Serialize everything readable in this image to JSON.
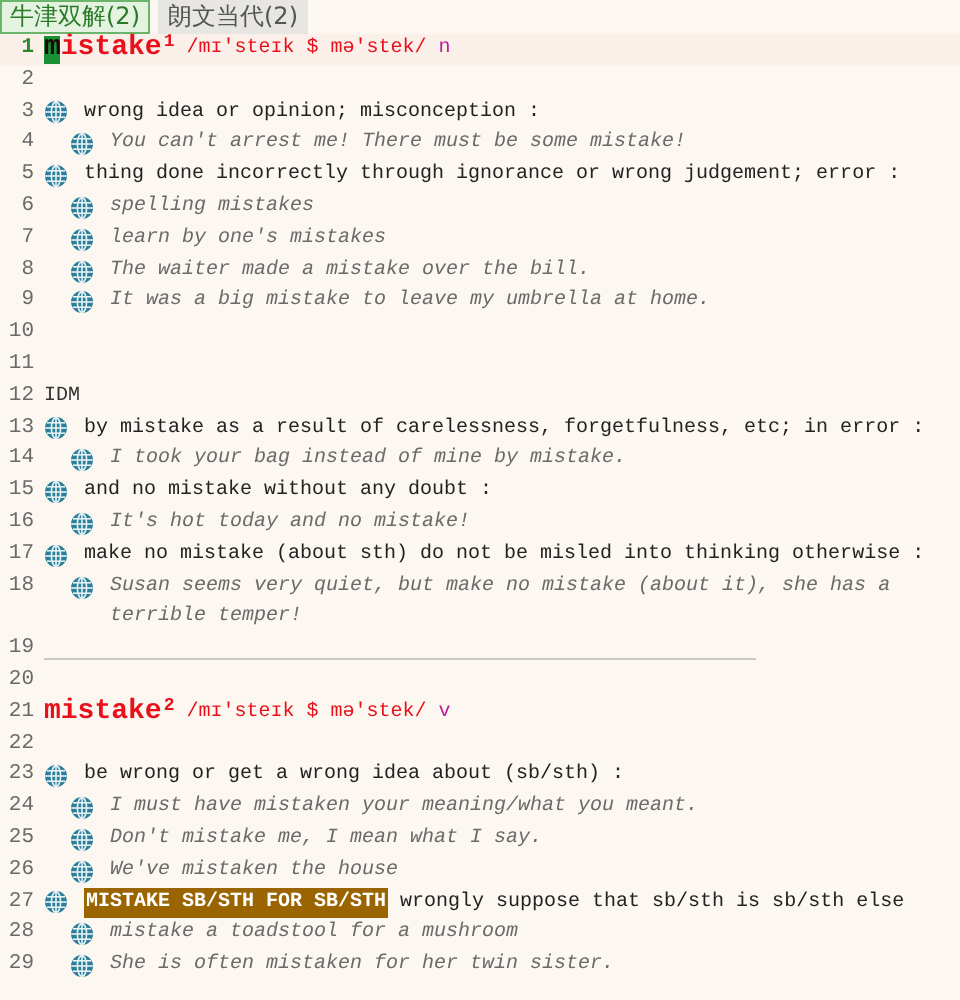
{
  "tabs": [
    {
      "label": "牛津双解(2)",
      "selected": true
    },
    {
      "label": "朗文当代(2)",
      "selected": false
    }
  ],
  "lines": [
    {
      "number": "1",
      "kind": "headword",
      "current": true,
      "cursor": true,
      "word": "mistake",
      "homograph": "1",
      "pron": "/mɪ'steɪk $ mə'stek/",
      "pos": "n"
    },
    {
      "number": "2",
      "kind": "blank"
    },
    {
      "number": "3",
      "kind": "sense",
      "text": "wrong idea or opinion; misconception :"
    },
    {
      "number": "4",
      "kind": "example",
      "text": "You can't arrest me! There must be some mistake!"
    },
    {
      "number": "5",
      "kind": "sense",
      "text": "thing done incorrectly through ignorance or wrong judgement; error :"
    },
    {
      "number": "6",
      "kind": "example",
      "text": "spelling mistakes"
    },
    {
      "number": "7",
      "kind": "example",
      "text": "learn by one's mistakes"
    },
    {
      "number": "8",
      "kind": "example",
      "text": "The waiter made a mistake over the bill."
    },
    {
      "number": "9",
      "kind": "example",
      "text": "It was a big mistake to leave my umbrella at home."
    },
    {
      "number": "10",
      "kind": "blank"
    },
    {
      "number": "11",
      "kind": "blank"
    },
    {
      "number": "12",
      "kind": "label",
      "text": "IDM"
    },
    {
      "number": "13",
      "kind": "sense",
      "text": "by mistake as a result of carelessness, forgetfulness, etc; in error :"
    },
    {
      "number": "14",
      "kind": "example",
      "text": "I took your bag instead of mine by mistake."
    },
    {
      "number": "15",
      "kind": "sense",
      "text": "and no mistake without any doubt :"
    },
    {
      "number": "16",
      "kind": "example",
      "text": "It's hot today and no mistake!"
    },
    {
      "number": "17",
      "kind": "sense",
      "text": "make no mistake (about sth) do not be misled into thinking otherwise :"
    },
    {
      "number": "18",
      "kind": "example",
      "text": "Susan seems very quiet, but make no mistake (about it), she has a terrible temper!"
    },
    {
      "number": "19",
      "kind": "rule"
    },
    {
      "number": "20",
      "kind": "blank"
    },
    {
      "number": "21",
      "kind": "headword",
      "current": false,
      "cursor": false,
      "word": "mistake",
      "homograph": "2",
      "pron": "/mɪ'steɪk $ mə'stek/",
      "pos": "v"
    },
    {
      "number": "22",
      "kind": "blank"
    },
    {
      "number": "23",
      "kind": "sense",
      "text": "be wrong or get a wrong idea about (sb/sth) :"
    },
    {
      "number": "24",
      "kind": "example",
      "text": "I must have mistaken your meaning/what you meant."
    },
    {
      "number": "25",
      "kind": "example",
      "text": "Don't mistake me, I mean what I say."
    },
    {
      "number": "26",
      "kind": "example",
      "text": "We've mistaken the house"
    },
    {
      "number": "27",
      "kind": "sense",
      "phrase": "MISTAKE SB/STH FOR SB/STH",
      "text": "wrongly suppose that sb/sth is sb/sth else"
    },
    {
      "number": "28",
      "kind": "example",
      "text": "mistake a toadstool for a mushroom"
    },
    {
      "number": "29",
      "kind": "example",
      "text": "She is often mistaken for her twin sister."
    }
  ]
}
